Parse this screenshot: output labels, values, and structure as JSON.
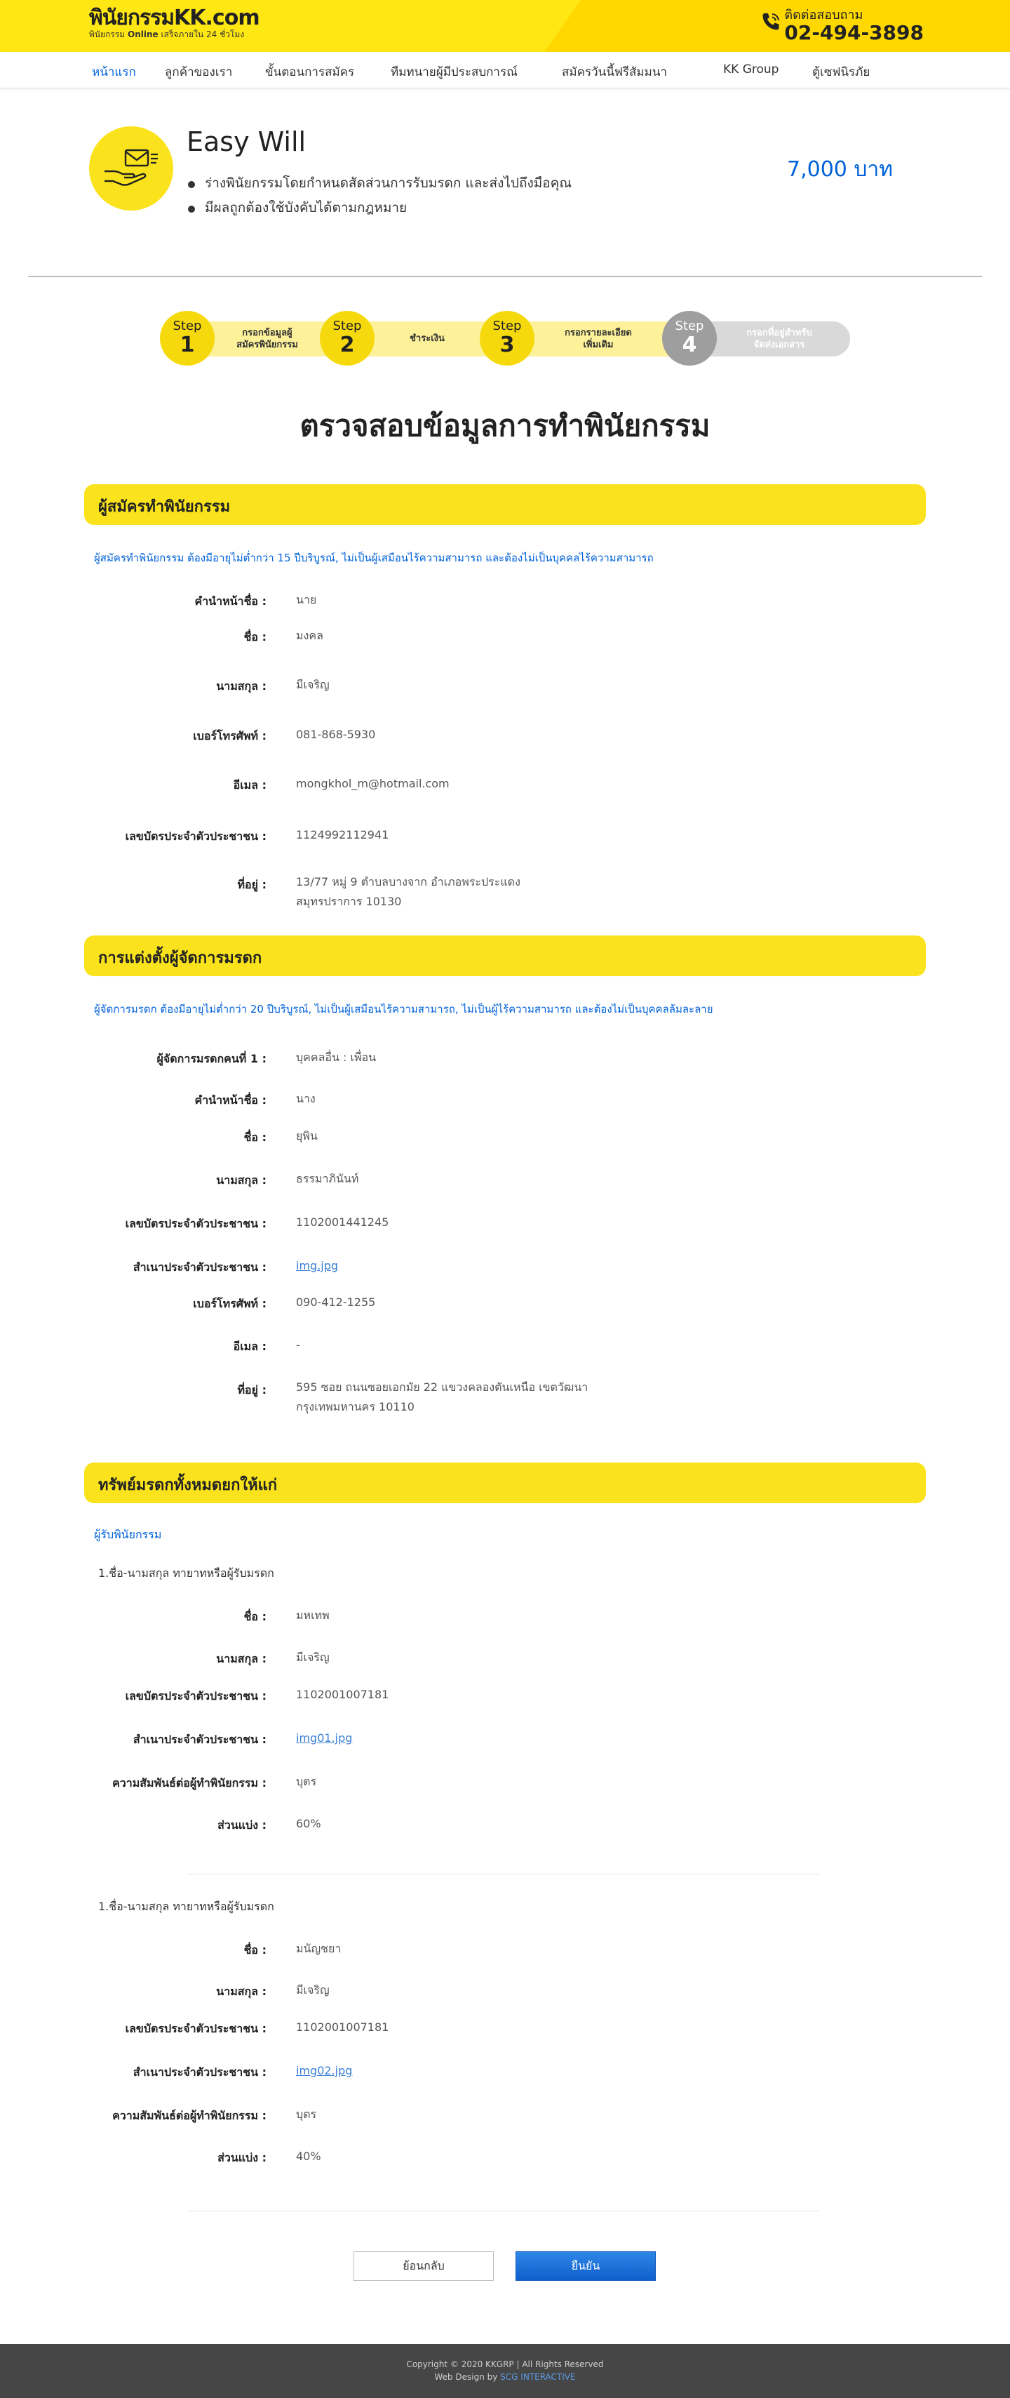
{
  "header": {
    "logo_main": "พินัยกรรม",
    "logo_kk": "KK",
    "logo_domain": ".com",
    "logo_sub_prefix": "พินัยกรรม",
    "logo_sub_bold": "Online",
    "logo_sub_suffix": "เสร็จภายใน 24 ชั่วโมง",
    "contact_label": "ติดต่อสอบถาม",
    "contact_phone": "02-494-3898"
  },
  "nav": {
    "items": [
      "หน้าแรก",
      "ลูกค้าของเรา",
      "ขั้นตอนการสมัคร",
      "ทีมทนายผู้มีประสบการณ์",
      "สมัครวันนี้ฟรีสัมมนา",
      "KK Group",
      "ตู้เซฟนิรภัย"
    ],
    "active_color": "#0061d9"
  },
  "product": {
    "name": "Easy Will",
    "bullets": [
      "ร่างพินัยกรรมโดยกำหนดสัดส่วนการรับมรดก และส่งไปถึงมือคุณ",
      "มีผลถูกต้องใช้บังคับได้ตามกฎหมาย"
    ],
    "price": "7,000 บาท"
  },
  "steps": [
    {
      "step": "Step",
      "number": "1",
      "label_1": "กรอกข้อมูลผู้",
      "label_2": "สมัครพินัยกรรม"
    },
    {
      "step": "Step",
      "number": "2",
      "label_1": "ชำระเงิน",
      "label_2": ""
    },
    {
      "step": "Step",
      "number": "3",
      "label_1": "กรอกรายละเอียด",
      "label_2": "เพิ่มเติม"
    },
    {
      "step": "Step",
      "number": "4",
      "label_1": "กรอกที่อยู่สำหรับ",
      "label_2": "จัดส่งเอกสาร"
    }
  ],
  "page_title": "ตรวจสอบข้อมูลการทำพินัยกรรม",
  "testator": {
    "heading": "ผู้สมัครทำพินัยกรรม",
    "note": "ผู้สมัครทำพินัยกรรม ต้องมีอายุไม่ต่ำกว่า 15 ปีบริบูรณ์, ไม่เป็นผู้เสมือนไร้ความสามารถ และต้องไม่เป็นบุคคลไร้ความสามารถ",
    "fields": [
      {
        "label": "คำนำหน้าชื่อ :",
        "value": "นาย"
      },
      {
        "label": "ชื่อ :",
        "value": "มงคล"
      },
      {
        "label": "นามสกุล :",
        "value": "มีเจริญ"
      },
      {
        "label": "เบอร์โทรศัพท์ :",
        "value": "081-868-5930"
      },
      {
        "label": "อีเมล :",
        "value": "mongkhol_m@hotmail.com"
      },
      {
        "label": "เลขบัตรประจำตัวประชาชน :",
        "value": "1124992112941"
      },
      {
        "label": "ที่อยู่ :",
        "value": "13/77 หมู่ 9 ตำบลบางจาก อำเภอพระประแดง",
        "value_2": "สมุทรปราการ 10130"
      }
    ]
  },
  "executor": {
    "heading": "การแต่งตั้งผู้จัดการมรดก",
    "note": "ผู้จัดการมรดก ต้องมีอายุไม่ต่ำกว่า 20 ปีบริบูรณ์, ไม่เป็นผู้เสมือนไร้ความสามารถ, ไม่เป็นผู้ไร้ความสามารถ และต้องไม่เป็นบุคคลล้มละลาย",
    "fields": [
      {
        "label": "ผู้จัดการมรดกคนที่ 1 :",
        "value": "บุคคลอื่น : เพื่อน"
      },
      {
        "label": "คำนำหน้าชื่อ :",
        "value": "นาง"
      },
      {
        "label": "ชื่อ :",
        "value": "ยุพิน"
      },
      {
        "label": "นามสกุล :",
        "value": "ธรรมาภินันท์"
      },
      {
        "label": "เลขบัตรประจำตัวประชาชน :",
        "value": "1102001441245"
      },
      {
        "label": "สำเนาประจำตัวประชาชน :",
        "value": "img.jpg"
      },
      {
        "label": "เบอร์โทรศัพท์ :",
        "value": "090-412-1255"
      },
      {
        "label": "อีเมล :",
        "value": "-"
      },
      {
        "label": "ที่อยู่ :",
        "value": "595 ซอย ถนนซอยเอกมัย 22 แขวงคลองตันเหนือ เขตวัฒนา",
        "value_2": "กรุงเทพมหานคร 10110"
      }
    ]
  },
  "assets": {
    "heading": "ทรัพย์มรดกทั้งหมดยกให้แก่",
    "sub_note": "ผู้รับพินัยกรรม",
    "heirs": [
      {
        "title": "1.ชื่อ-นามสกุล ทายาทหรือผู้รับมรดก",
        "fields": [
          {
            "label": "ชื่อ :",
            "value": "มหเทพ"
          },
          {
            "label": "นามสกุล :",
            "value": "มีเจริญ"
          },
          {
            "label": "เลขบัตรประจำตัวประชาชน :",
            "value": "1102001007181"
          },
          {
            "label": "สำเนาประจำตัวประชาชน :",
            "value": "img01.jpg"
          },
          {
            "label": "ความสัมพันธ์ต่อผู้ทำพินัยกรรม :",
            "value": "บุตร"
          },
          {
            "label": "ส่วนแบ่ง :",
            "value": "60%"
          }
        ]
      },
      {
        "title": "1.ชื่อ-นามสกุล ทายาทหรือผู้รับมรดก",
        "fields": [
          {
            "label": "ชื่อ :",
            "value": "มนัญชยา"
          },
          {
            "label": "นามสกุล :",
            "value": "มีเจริญ"
          },
          {
            "label": "เลขบัตรประจำตัวประชาชน :",
            "value": "1102001007181"
          },
          {
            "label": "สำเนาประจำตัวประชาชน :",
            "value": "img02.jpg"
          },
          {
            "label": "ความสัมพันธ์ต่อผู้ทำพินัยกรรม :",
            "value": "บุตร"
          },
          {
            "label": "ส่วนแบ่ง :",
            "value": "40%"
          }
        ]
      }
    ]
  },
  "buttons": {
    "back": "ย้อนกลับ",
    "confirm": "ยืนยัน"
  },
  "footer": {
    "copyright": "Copyright © 2020 KKGRP | All Rights Reserved",
    "credit_prefix": "Web Design by",
    "credit_link": "SCG INTERACTIVE"
  }
}
